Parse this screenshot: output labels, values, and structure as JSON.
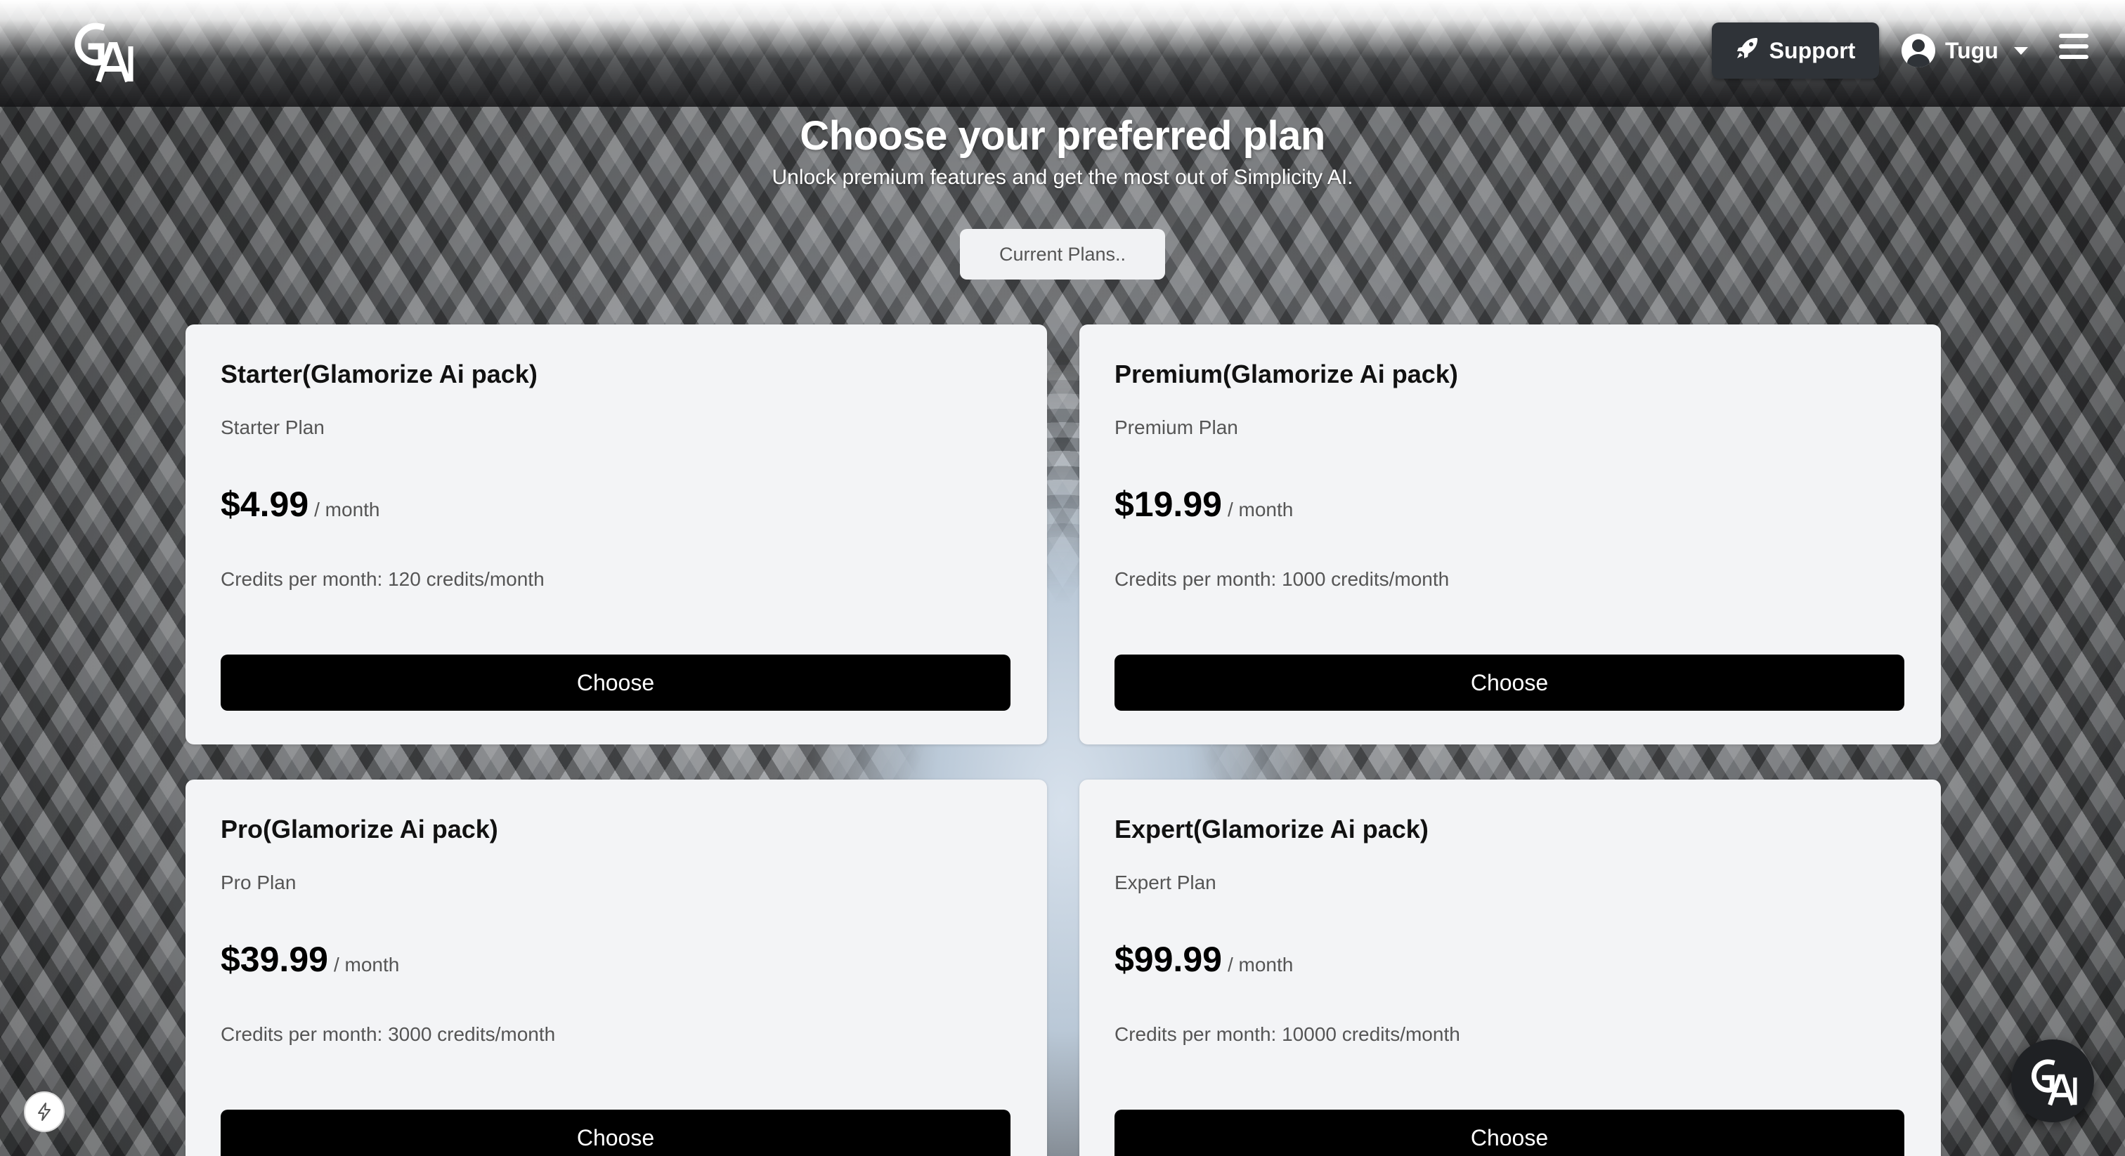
{
  "header": {
    "logo_text": "GAi",
    "support_label": "Support",
    "user_name": "Tugu"
  },
  "hero": {
    "title": "Choose your preferred plan",
    "subtitle": "Unlock premium features and get the most out of Simplicity AI.",
    "current_plans_label": "Current Plans.."
  },
  "plans": [
    {
      "title": "Starter(Glamorize Ai pack)",
      "subtitle": "Starter Plan",
      "price": "$4.99",
      "period": "/ month",
      "credits": "Credits per month: 120 credits/month",
      "button": "Choose"
    },
    {
      "title": "Premium(Glamorize Ai pack)",
      "subtitle": "Premium Plan",
      "price": "$19.99",
      "period": "/ month",
      "credits": "Credits per month: 1000 credits/month",
      "button": "Choose"
    },
    {
      "title": "Pro(Glamorize Ai pack)",
      "subtitle": "Pro Plan",
      "price": "$39.99",
      "period": "/ month",
      "credits": "Credits per month: 3000 credits/month",
      "button": "Choose"
    },
    {
      "title": "Expert(Glamorize Ai pack)",
      "subtitle": "Expert Plan",
      "price": "$99.99",
      "period": "/ month",
      "credits": "Credits per month: 10000 credits/month",
      "button": "Choose"
    }
  ],
  "widgets": {
    "bolt_icon": "lightning-icon",
    "chat_logo_text": "GAi"
  },
  "colors": {
    "button_bg": "#000000",
    "card_bg": "#f3f4f6",
    "support_bg": "#2f3338"
  }
}
